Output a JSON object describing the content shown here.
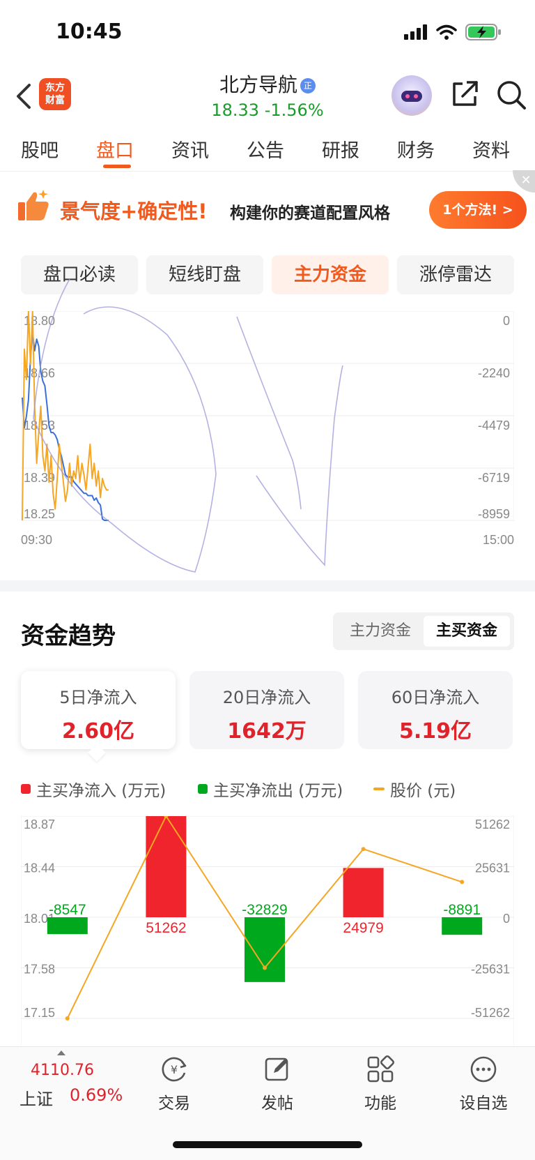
{
  "status": {
    "time": "10:45"
  },
  "header": {
    "logo_lines": [
      "东方",
      "财富"
    ],
    "stock_name": "北方导航",
    "verify_badge": "正",
    "price": "18.33",
    "change_pct": "-1.56%"
  },
  "tabs": [
    "股吧",
    "盘口",
    "资讯",
    "公告",
    "研报",
    "财务",
    "资料"
  ],
  "active_tab": "盘口",
  "banner": {
    "title": "景气度+确定性!",
    "subtitle": "构建你的赛道配置风格",
    "button": "1个方法! >"
  },
  "segments": [
    "盘口必读",
    "短线盯盘",
    "主力资金",
    "涨停雷达"
  ],
  "active_segment": "主力资金",
  "chart_data": [
    {
      "type": "line",
      "title": "",
      "x_labels": [
        "09:30",
        "15:00"
      ],
      "y_left_ticks": [
        "18.80",
        "18.66",
        "18.53",
        "18.39",
        "18.25"
      ],
      "y_right_ticks": [
        "0",
        "-2240",
        "-4479",
        "-6719",
        "-8959"
      ],
      "ylim_left": [
        18.25,
        18.8
      ],
      "ylim_right": [
        -8959,
        0
      ],
      "grid": true,
      "series": [
        {
          "color": "#3a6fd8",
          "axis": "right",
          "values": [
            -3700,
            -5000,
            -4500,
            -3800,
            -2000,
            -900,
            -1700,
            -1200,
            -1500,
            -2600,
            -3000,
            -3200,
            -4000,
            -4900,
            -5200,
            -5200,
            -5300,
            -5500,
            -5900,
            -6200,
            -6600,
            -7000,
            -7100,
            -7100,
            -7100,
            -7300,
            -7400,
            -7500,
            -7600,
            -7700,
            -7800,
            -7800,
            -7900,
            -7900,
            -7900,
            -8100,
            -8000,
            -8200,
            -8300,
            -8900,
            -9100,
            -9100,
            -9100
          ]
        },
        {
          "color": "#f5a623",
          "axis": "left",
          "values": [
            18.25,
            18.7,
            18.62,
            18.8,
            18.66,
            18.8,
            18.55,
            18.4,
            18.48,
            18.55,
            18.42,
            18.38,
            18.45,
            18.35,
            18.42,
            18.32,
            18.28,
            18.36,
            18.45,
            18.4,
            18.35,
            18.3,
            18.33,
            18.4,
            18.34,
            18.38,
            18.36,
            18.42,
            18.35,
            18.4,
            18.37,
            18.33,
            18.39,
            18.45,
            18.36,
            18.4,
            18.34,
            18.38,
            18.31,
            18.36,
            18.34,
            18.33,
            18.33
          ]
        }
      ]
    },
    {
      "type": "bar",
      "title": "",
      "y_left_ticks": [
        "18.87",
        "18.44",
        "18.01",
        "17.58",
        "17.15"
      ],
      "y_right_ticks": [
        "51262",
        "25631",
        "0",
        "-25631",
        "-51262"
      ],
      "ylim_left": [
        17.15,
        18.87
      ],
      "ylim_right": [
        -51262,
        51262
      ],
      "grid": true,
      "bar_values": [
        -8547,
        51262,
        -32829,
        24979,
        -8891
      ],
      "bar_labels": [
        "-8547",
        "51262",
        "-32829",
        "24979",
        "-8891"
      ],
      "inflow_color": "#f0242c",
      "outflow_color": "#00a81e",
      "price_color": "#f5a623",
      "price_values": [
        17.15,
        18.87,
        17.58,
        18.59,
        18.31
      ]
    }
  ],
  "trend": {
    "title": "资金趋势",
    "toggle": [
      "主力资金",
      "主买资金"
    ],
    "toggle_active": "主买资金",
    "cards": [
      {
        "label": "5日净流入",
        "value": "2.60亿"
      },
      {
        "label": "20日净流入",
        "value": "1642万"
      },
      {
        "label": "60日净流入",
        "value": "5.19亿"
      }
    ],
    "legend": {
      "inflow": "主买净流入 (万元)",
      "outflow": "主买净流出 (万元)",
      "price": "股价 (元)"
    }
  },
  "bottom": {
    "index_value": "4110.76",
    "index_name": "上证",
    "index_change": "0.69%",
    "items": [
      {
        "label": "交易",
        "icon": "yuan-refresh-icon"
      },
      {
        "label": "发帖",
        "icon": "edit-icon"
      },
      {
        "label": "功能",
        "icon": "grid-icon"
      },
      {
        "label": "设自选",
        "icon": "more-circle-icon"
      }
    ]
  }
}
